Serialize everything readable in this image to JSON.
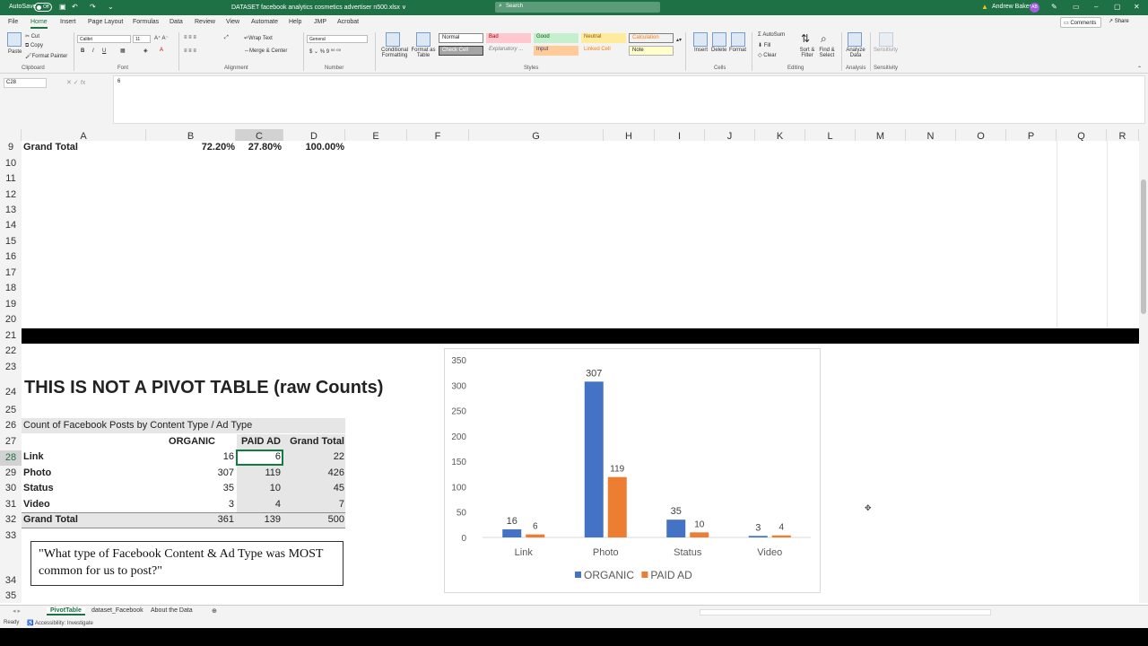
{
  "titlebar": {
    "autosave": "AutoSave",
    "toggle": "Off",
    "doc_title": "DATASET facebook analytics cosmetics advertiser n500.xlsx ∨",
    "search_placeholder": "Search",
    "user": "Andrew Baker",
    "initials": "AB"
  },
  "menu": {
    "tabs": [
      "File",
      "Home",
      "Insert",
      "Page Layout",
      "Formulas",
      "Data",
      "Review",
      "View",
      "Automate",
      "Help",
      "JMP",
      "Acrobat"
    ],
    "comments": "Comments",
    "share": "Share"
  },
  "ribbon": {
    "clipboard": {
      "paste": "Paste",
      "cut": "Cut",
      "copy": "Copy",
      "format_painter": "Format Painter",
      "label": "Clipboard"
    },
    "font": {
      "name": "Calibri",
      "size": "11",
      "label": "Font"
    },
    "alignment": {
      "wrap": "Wrap Text",
      "merge": "Merge & Center",
      "label": "Alignment"
    },
    "number": {
      "format": "General",
      "label": "Number"
    },
    "styles": {
      "conditional": "Conditional Formatting",
      "format_table": "Format as Table",
      "cells": [
        "Normal",
        "Bad",
        "Good",
        "Neutral",
        "Calculation",
        "Check Cell",
        "Explanatory ...",
        "Input",
        "Linked Cell",
        "Note"
      ],
      "label": "Styles"
    },
    "cells": {
      "insert": "Insert",
      "delete": "Delete",
      "format": "Format",
      "label": "Cells"
    },
    "editing": {
      "autosum": "AutoSum",
      "fill": "Fill",
      "clear": "Clear",
      "sort": "Sort & Filter",
      "find": "Find & Select",
      "label": "Editing"
    },
    "analysis": {
      "analyze": "Analyze Data",
      "label": "Analysis"
    },
    "sensitivity": {
      "button": "Sensitivity",
      "label": "Sensitivity"
    }
  },
  "formula": {
    "name_box": "C28",
    "value": "6"
  },
  "columns": [
    "A",
    "B",
    "C",
    "D",
    "E",
    "F",
    "G",
    "H",
    "I",
    "J",
    "K",
    "L",
    "M",
    "N",
    "O",
    "P",
    "Q",
    "R"
  ],
  "rows": [
    "9",
    "10",
    "11",
    "12",
    "13",
    "14",
    "15",
    "16",
    "17",
    "18",
    "19",
    "20",
    "21",
    "22",
    "23",
    "24",
    "25",
    "26",
    "27",
    "28",
    "29",
    "30",
    "31",
    "32",
    "33",
    "34",
    "35"
  ],
  "sheet": {
    "row9": {
      "label": "Grand Total",
      "b": "72.20%",
      "c": "27.80%",
      "d": "100.00%"
    },
    "heading": "THIS IS NOT A PIVOT TABLE (raw Counts)",
    "table": {
      "caption": "Count of Facebook Posts by Content Type / Ad Type",
      "headers": [
        "ORGANIC",
        "PAID AD",
        "Grand Total"
      ],
      "rows": [
        {
          "label": "Link",
          "organic": "16",
          "paid": "6",
          "total": "22"
        },
        {
          "label": "Photo",
          "organic": "307",
          "paid": "119",
          "total": "426"
        },
        {
          "label": "Status",
          "organic": "35",
          "paid": "10",
          "total": "45"
        },
        {
          "label": "Video",
          "organic": "3",
          "paid": "4",
          "total": "7"
        }
      ],
      "total": {
        "label": "Grand Total",
        "organic": "361",
        "paid": "139",
        "total": "500"
      }
    },
    "question": "\"What type of Facebook Content & Ad Type was MOST common for us to post?\""
  },
  "chart_data": {
    "type": "bar",
    "categories": [
      "Link",
      "Photo",
      "Status",
      "Video"
    ],
    "series": [
      {
        "name": "ORGANIC",
        "values": [
          16,
          307,
          35,
          3
        ],
        "color": "#4472c4"
      },
      {
        "name": "PAID AD",
        "values": [
          6,
          119,
          10,
          4
        ],
        "color": "#ed7d31"
      }
    ],
    "y_ticks": [
      "0",
      "50",
      "100",
      "150",
      "200",
      "250",
      "300",
      "350"
    ],
    "ylim": [
      0,
      350
    ],
    "legend": "bottom",
    "grid": false
  },
  "sheet_tabs": [
    "PivotTable",
    "dataset_Facebook",
    "About the Data"
  ],
  "status": {
    "ready": "Ready",
    "accessibility": "Accessibility: Investigate"
  }
}
